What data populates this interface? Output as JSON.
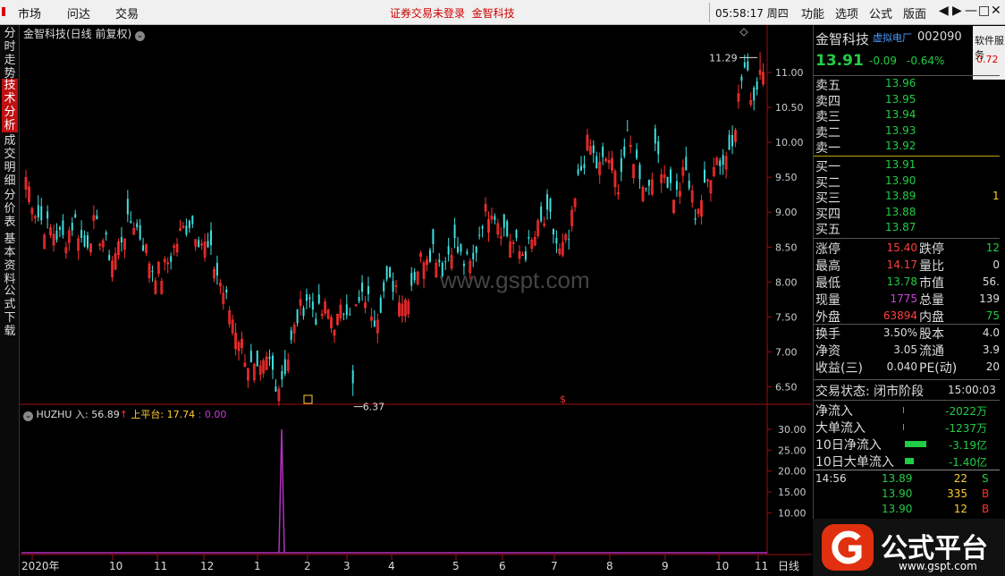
{
  "menu": {
    "items": [
      "市场",
      "问达",
      "交易"
    ]
  },
  "notice": {
    "text": "证券交易未登录",
    "stock": "金智科技"
  },
  "clock": "05:58:17 周四",
  "rmenu": {
    "items": [
      "功能",
      "选项",
      "公式",
      "版面"
    ]
  },
  "controls": {
    "back": "◀",
    "fwd": "▶",
    "min": "—",
    "max": "□",
    "close": "✕"
  },
  "lefttabs": [
    {
      "label": "分时走势",
      "active": false
    },
    {
      "label": "技术分析",
      "active": true
    },
    {
      "label": "成交明细",
      "active": false
    },
    {
      "label": "分价表",
      "active": false
    },
    {
      "label": "基本资料",
      "active": false
    },
    {
      "label": "公式下载",
      "active": false
    }
  ],
  "chart": {
    "title": "金智科技(日线 前复权)",
    "watermark": "www.gspt.com",
    "high_label": "11.29",
    "low_label": "6.37",
    "sub_title": "HUZHU",
    "sub_in_label": "入: 56.89",
    "sub_up_label": "上平台: 17.74",
    "sub_third_label": ": 0.00",
    "period_label": "日线"
  },
  "colors": {
    "up": "#ff3030",
    "down": "#40e0e0",
    "axis": "#9b1010",
    "purple": "#b030c0",
    "green": "#22cc44",
    "yellow": "#ffcc33"
  },
  "chart_data": {
    "type": "candlestick",
    "title": "金智科技(日线 前复权)",
    "y_ticks": [
      6.5,
      7.0,
      7.5,
      8.0,
      8.5,
      9.0,
      9.5,
      10.0,
      10.5,
      11.0
    ],
    "ylim": [
      6.25,
      11.5
    ],
    "x_tick_labels": [
      "2020年",
      "10",
      "11",
      "12",
      "1",
      "2",
      "3",
      "4",
      "5",
      "6",
      "7",
      "8",
      "9",
      "10",
      "11"
    ],
    "high": 11.29,
    "low": 6.37,
    "close_path": [
      9.5,
      9.0,
      8.8,
      8.7,
      8.6,
      8.9,
      8.5,
      8.8,
      8.6,
      8.3,
      8.7,
      8.9,
      8.6,
      8.2,
      8.1,
      8.4,
      8.7,
      8.9,
      8.6,
      8.4,
      8.0,
      7.6,
      7.2,
      6.8,
      6.6,
      6.9,
      6.5,
      6.9,
      7.5,
      7.8,
      7.5,
      7.6,
      7.4,
      7.7,
      7.6,
      7.8,
      7.5,
      7.9,
      8.0,
      7.7,
      8.1,
      8.4,
      8.5,
      8.2,
      8.6,
      8.3,
      8.2,
      8.9,
      9.1,
      8.8,
      8.6,
      8.4,
      8.5,
      8.8,
      8.9,
      8.4,
      8.6,
      9.5,
      10.0,
      9.6,
      9.8,
      9.4,
      10.0,
      9.7,
      9.3,
      9.9,
      9.5,
      9.2,
      9.6,
      9.0,
      9.3,
      9.8,
      9.7,
      10.2,
      11.1,
      10.6,
      11.29
    ],
    "indicator": {
      "name": "HUZHU",
      "in": 56.89,
      "upper_platform": 17.74,
      "third": 0.0,
      "y_ticks": [
        10.0,
        15.0,
        20.0,
        25.0,
        30.0
      ],
      "spike_position": "near 2月",
      "spike_value": 30.0
    }
  },
  "quote": {
    "name": "金智科技",
    "tag": "虚拟电厂",
    "code": "002090",
    "side_tab": "软件服务",
    "side_tab_red": "0.72",
    "price": "13.91",
    "change": "-0.09",
    "change_pct": "-0.64%"
  },
  "orderbook": {
    "asks": [
      {
        "label": "卖五",
        "price": "13.96"
      },
      {
        "label": "卖四",
        "price": "13.95"
      },
      {
        "label": "卖三",
        "price": "13.94"
      },
      {
        "label": "卖二",
        "price": "13.93"
      },
      {
        "label": "卖一",
        "price": "13.92"
      }
    ],
    "bids": [
      {
        "label": "买一",
        "price": "13.91"
      },
      {
        "label": "买二",
        "price": "13.90"
      },
      {
        "label": "买三",
        "price": "13.89",
        "vol": "1"
      },
      {
        "label": "买四",
        "price": "13.88"
      },
      {
        "label": "买五",
        "price": "13.87"
      }
    ]
  },
  "stats": [
    {
      "l1": "涨停",
      "v1": "15.40",
      "c1": "#ff4040",
      "l2": "跌停",
      "v2": "12",
      "c2": "#22cc44"
    },
    {
      "l1": "最高",
      "v1": "14.17",
      "c1": "#ff4040",
      "l2": "量比",
      "v2": "0",
      "c2": "#ddd"
    },
    {
      "l1": "最低",
      "v1": "13.78",
      "c1": "#22cc44",
      "l2": "市值",
      "v2": "56.",
      "c2": "#ddd"
    },
    {
      "l1": "现量",
      "v1": "1775",
      "c1": "#d040e0",
      "l2": "总量",
      "v2": "139",
      "c2": "#ddd"
    },
    {
      "l1": "外盘",
      "v1": "63894",
      "c1": "#ff4040",
      "l2": "内盘",
      "v2": "75",
      "c2": "#22cc44"
    },
    {
      "l1": "换手",
      "v1": "3.50%",
      "c1": "#ddd",
      "l2": "股本",
      "v2": "4.0",
      "c2": "#ddd"
    },
    {
      "l1": "净资",
      "v1": "3.05",
      "c1": "#ddd",
      "l2": "流通",
      "v2": "3.9",
      "c2": "#ddd"
    },
    {
      "l1": "收益(三)",
      "v1": "0.040",
      "c1": "#ddd",
      "l2": "PE(动)",
      "v2": "20",
      "c2": "#ddd"
    }
  ],
  "trade_status": {
    "label": "交易状态: 闭市阶段",
    "time": "15:00:03"
  },
  "flows": [
    {
      "label": "净流入",
      "value": "-2022万"
    },
    {
      "label": "大单流入",
      "value": "-1237万"
    },
    {
      "label": "10日净流入",
      "value": "-3.19亿"
    },
    {
      "label": "10日大单流入",
      "value": "-1.40亿"
    }
  ],
  "ticks": [
    {
      "time": "14:56",
      "price": "13.89",
      "vol": "22",
      "side": "S"
    },
    {
      "time": "",
      "price": "13.90",
      "vol": "335",
      "side": "B"
    },
    {
      "time": "",
      "price": "13.90",
      "vol": "12",
      "side": "B"
    }
  ],
  "brand": {
    "name": "公式平台",
    "url": "www.gspt.com"
  }
}
